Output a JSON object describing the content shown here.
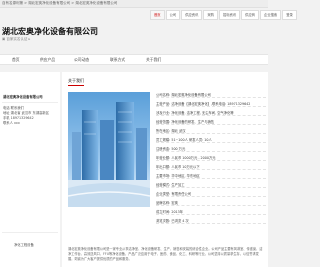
{
  "topbar": {
    "crumbs": "自有名源利第 > 湖北宏奥净化设备有限公司 > 湖北宏奥净化设备有限公司"
  },
  "nav": [
    "首页",
    "公司",
    "供应资讯",
    "采购",
    "招标资讯",
    "供应商",
    "企业搜索",
    "登录"
  ],
  "company": {
    "name": "湖北宏奥净化设备有限公司",
    "subline": "▣ 百家实名认证 ▸"
  },
  "tabs": [
    "首页",
    "供应产品",
    "公司动态",
    "联系方式",
    "关于我们"
  ],
  "left": {
    "company_short": "湖北宏奥净化设备有限公司",
    "contact_lines": [
      "电话 联系我们",
      "地址 湖北省 武汉市 东湖高新区",
      "手机 18971329642",
      "联系人 xxx"
    ],
    "category": "净化工程设备"
  },
  "main": {
    "section_title": "关于我们",
    "info": [
      "公司名称: 湖北宏奥净化设备有限公司",
      "主营产品: 洁净设备【湖北宏奥净化】,联系电话: 18971329642",
      "涉及行业: 净化设备, 洁净工程, 无尘车间, 空气净化等",
      "经营范围: 净化设备的研发、生产与销售",
      "所在地区: 湖北 武汉",
      "员工规模: 51~100人   研发人员: 10人",
      "注册资金: 500 万元",
      "年营业额: 人民币 1000万元 - 2000万元",
      "年出口额: 人民币 10万元以下",
      "主要市场: 华中地区, 华东地区",
      "经营模式: 生产加工",
      "企业类型: 有限责任公司",
      "品牌名称: 宏奥",
      "成立时间: 2013年",
      "浏览次数: 已浏览 4 次"
    ],
    "description": "湖北宏奥净化设备有限公司是一家专业从事洁净室、净化设备研发、生产、销售和安装的综合性企业。公司产品主要有风淋室、传递窗、洁净工作台、高效送风口、FFU等净化设备，产品广泛应用于电子、医药、食品、化工、科研等行业。公司坚持以质量求生存，以信誉求发展，竭诚为广大客户提供优质的产品和服务。"
  }
}
